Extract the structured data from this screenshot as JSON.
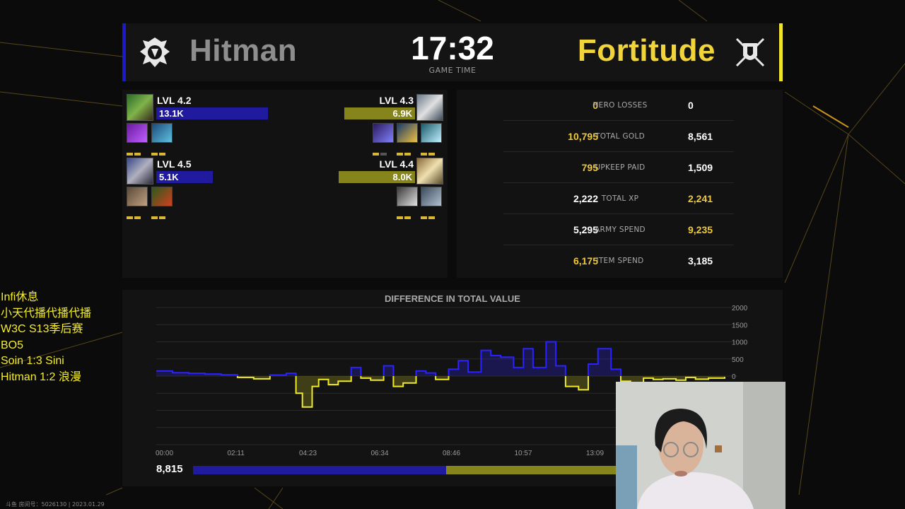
{
  "header": {
    "player1": "Hitman",
    "player2": "Fortitude",
    "game_time": "17:32",
    "game_time_label": "GAME TIME",
    "player1_color": "#1a18d0",
    "player2_color": "#f0e52a",
    "player1_emblem": "orc-emblem-icon",
    "player2_emblem": "human-emblem-icon"
  },
  "heroes": {
    "left": [
      {
        "level": "LVL 4.2",
        "value": "13.1K",
        "items": [
          "claw-icon",
          "orb-icon"
        ]
      },
      {
        "level": "LVL 4.5",
        "value": "5.1K",
        "items": [
          "shell-icon",
          "herb-icon"
        ]
      }
    ],
    "right": [
      {
        "level": "LVL 4.3",
        "value": "6.9K",
        "items": [
          "blade-icon",
          "staff-icon",
          "frost-icon"
        ]
      },
      {
        "level": "LVL 4.4",
        "value": "8.0K",
        "items": [
          "potion-icon",
          "scroll-icon"
        ]
      }
    ]
  },
  "stats": [
    {
      "left": "0",
      "label": "HERO LOSSES",
      "right": "0",
      "highlight": "left"
    },
    {
      "left": "10,795",
      "label": "TOTAL GOLD",
      "right": "8,561",
      "highlight": "left"
    },
    {
      "left": "795",
      "label": "UPKEEP PAID",
      "right": "1,509",
      "highlight": "left"
    },
    {
      "left": "2,222",
      "label": "TOTAL XP",
      "right": "2,241",
      "highlight": "right"
    },
    {
      "left": "5,295",
      "label": "ARMY SPEND",
      "right": "9,235",
      "highlight": "right"
    },
    {
      "left": "6,175",
      "label": "ITEM SPEND",
      "right": "3,185",
      "highlight": "left"
    }
  ],
  "chart_data": {
    "type": "line",
    "title": "DIFFERENCE IN TOTAL VALUE",
    "x_ticks": [
      "00:00",
      "02:11",
      "04:23",
      "06:34",
      "08:46",
      "10:57",
      "13:09"
    ],
    "y_ticks": [
      "2000",
      "1500",
      "1000",
      "500",
      "0"
    ],
    "ylim": [
      -2000,
      2000
    ],
    "series": [
      {
        "color": "#2a22ff",
        "negative_color": "#f0ea2a",
        "x_minutes": [
          0,
          0.5,
          1,
          1.5,
          2,
          2.5,
          3,
          3.5,
          4,
          4.3,
          4.5,
          4.8,
          5,
          5.3,
          5.6,
          6,
          6.3,
          6.6,
          7,
          7.3,
          7.6,
          8,
          8.3,
          8.6,
          9,
          9.3,
          9.6,
          10,
          10.3,
          10.6,
          11,
          11.3,
          11.6,
          12,
          12.3,
          12.6,
          13,
          13.3,
          13.6,
          14,
          14.3,
          14.6,
          15,
          15.3,
          15.6,
          16,
          16.3,
          16.6,
          17,
          17.5
        ],
        "values": [
          150,
          100,
          80,
          60,
          40,
          -40,
          -80,
          30,
          80,
          -500,
          -900,
          -300,
          -100,
          -250,
          -150,
          250,
          -60,
          -120,
          300,
          -300,
          -200,
          150,
          90,
          -100,
          200,
          450,
          120,
          750,
          600,
          550,
          250,
          800,
          250,
          1000,
          300,
          -300,
          -400,
          350,
          800,
          200,
          -150,
          -200,
          -60,
          -100,
          -80,
          -120,
          -40,
          -90,
          -60,
          -20
        ]
      }
    ]
  },
  "total_value": "8,815",
  "total_value_ratio": 0.597,
  "overlay_lines": [
    "Infi休息",
    "小天代播代播代播",
    "W3C S13季后赛",
    "BO5",
    "Soin 1:3 Sini",
    "Hitman 1:2 浪漫"
  ],
  "footer": "斗鱼 房间号：5026130 | 2023.01.29"
}
